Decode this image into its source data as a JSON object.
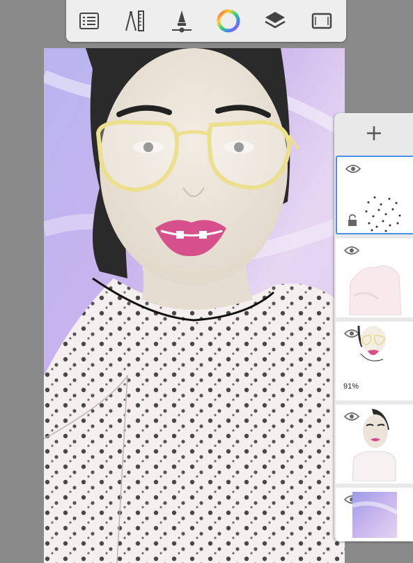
{
  "toolbar": {
    "items": [
      {
        "name": "layers-list-icon",
        "label": ""
      },
      {
        "name": "ruler-guides-icon",
        "label": ""
      },
      {
        "name": "brush-properties-icon",
        "label": ""
      },
      {
        "name": "color-wheel-icon",
        "label": ""
      },
      {
        "name": "layer-stack-icon",
        "label": ""
      },
      {
        "name": "fullscreen-icon",
        "label": ""
      }
    ]
  },
  "layers_panel": {
    "add_button_icon": "plus-icon",
    "layers": [
      {
        "name": "polka-dots-layer",
        "selected": true,
        "visible": true,
        "locked_icon": "lock-open-icon",
        "opacity_label": ""
      },
      {
        "name": "shirt-shading-layer",
        "selected": false,
        "visible": true,
        "opacity_label": ""
      },
      {
        "name": "glasses-lineart-layer",
        "selected": false,
        "visible": true,
        "opacity_label": "91%"
      },
      {
        "name": "portrait-layer",
        "selected": false,
        "visible": true,
        "opacity_label": ""
      },
      {
        "name": "background-layer",
        "selected": false,
        "visible": true,
        "opacity_label": ""
      }
    ]
  },
  "colors": {
    "accent": "#4a8fe6",
    "toolbar_bg": "#eeeeee",
    "workspace_bg": "#8a8a8a",
    "panel_bg": "#e9e9e9",
    "lens_frame": "#ecdf8e",
    "lips": "#d6508c",
    "skin": "#ece4d8",
    "sky_purple": "#b9a8e6"
  }
}
